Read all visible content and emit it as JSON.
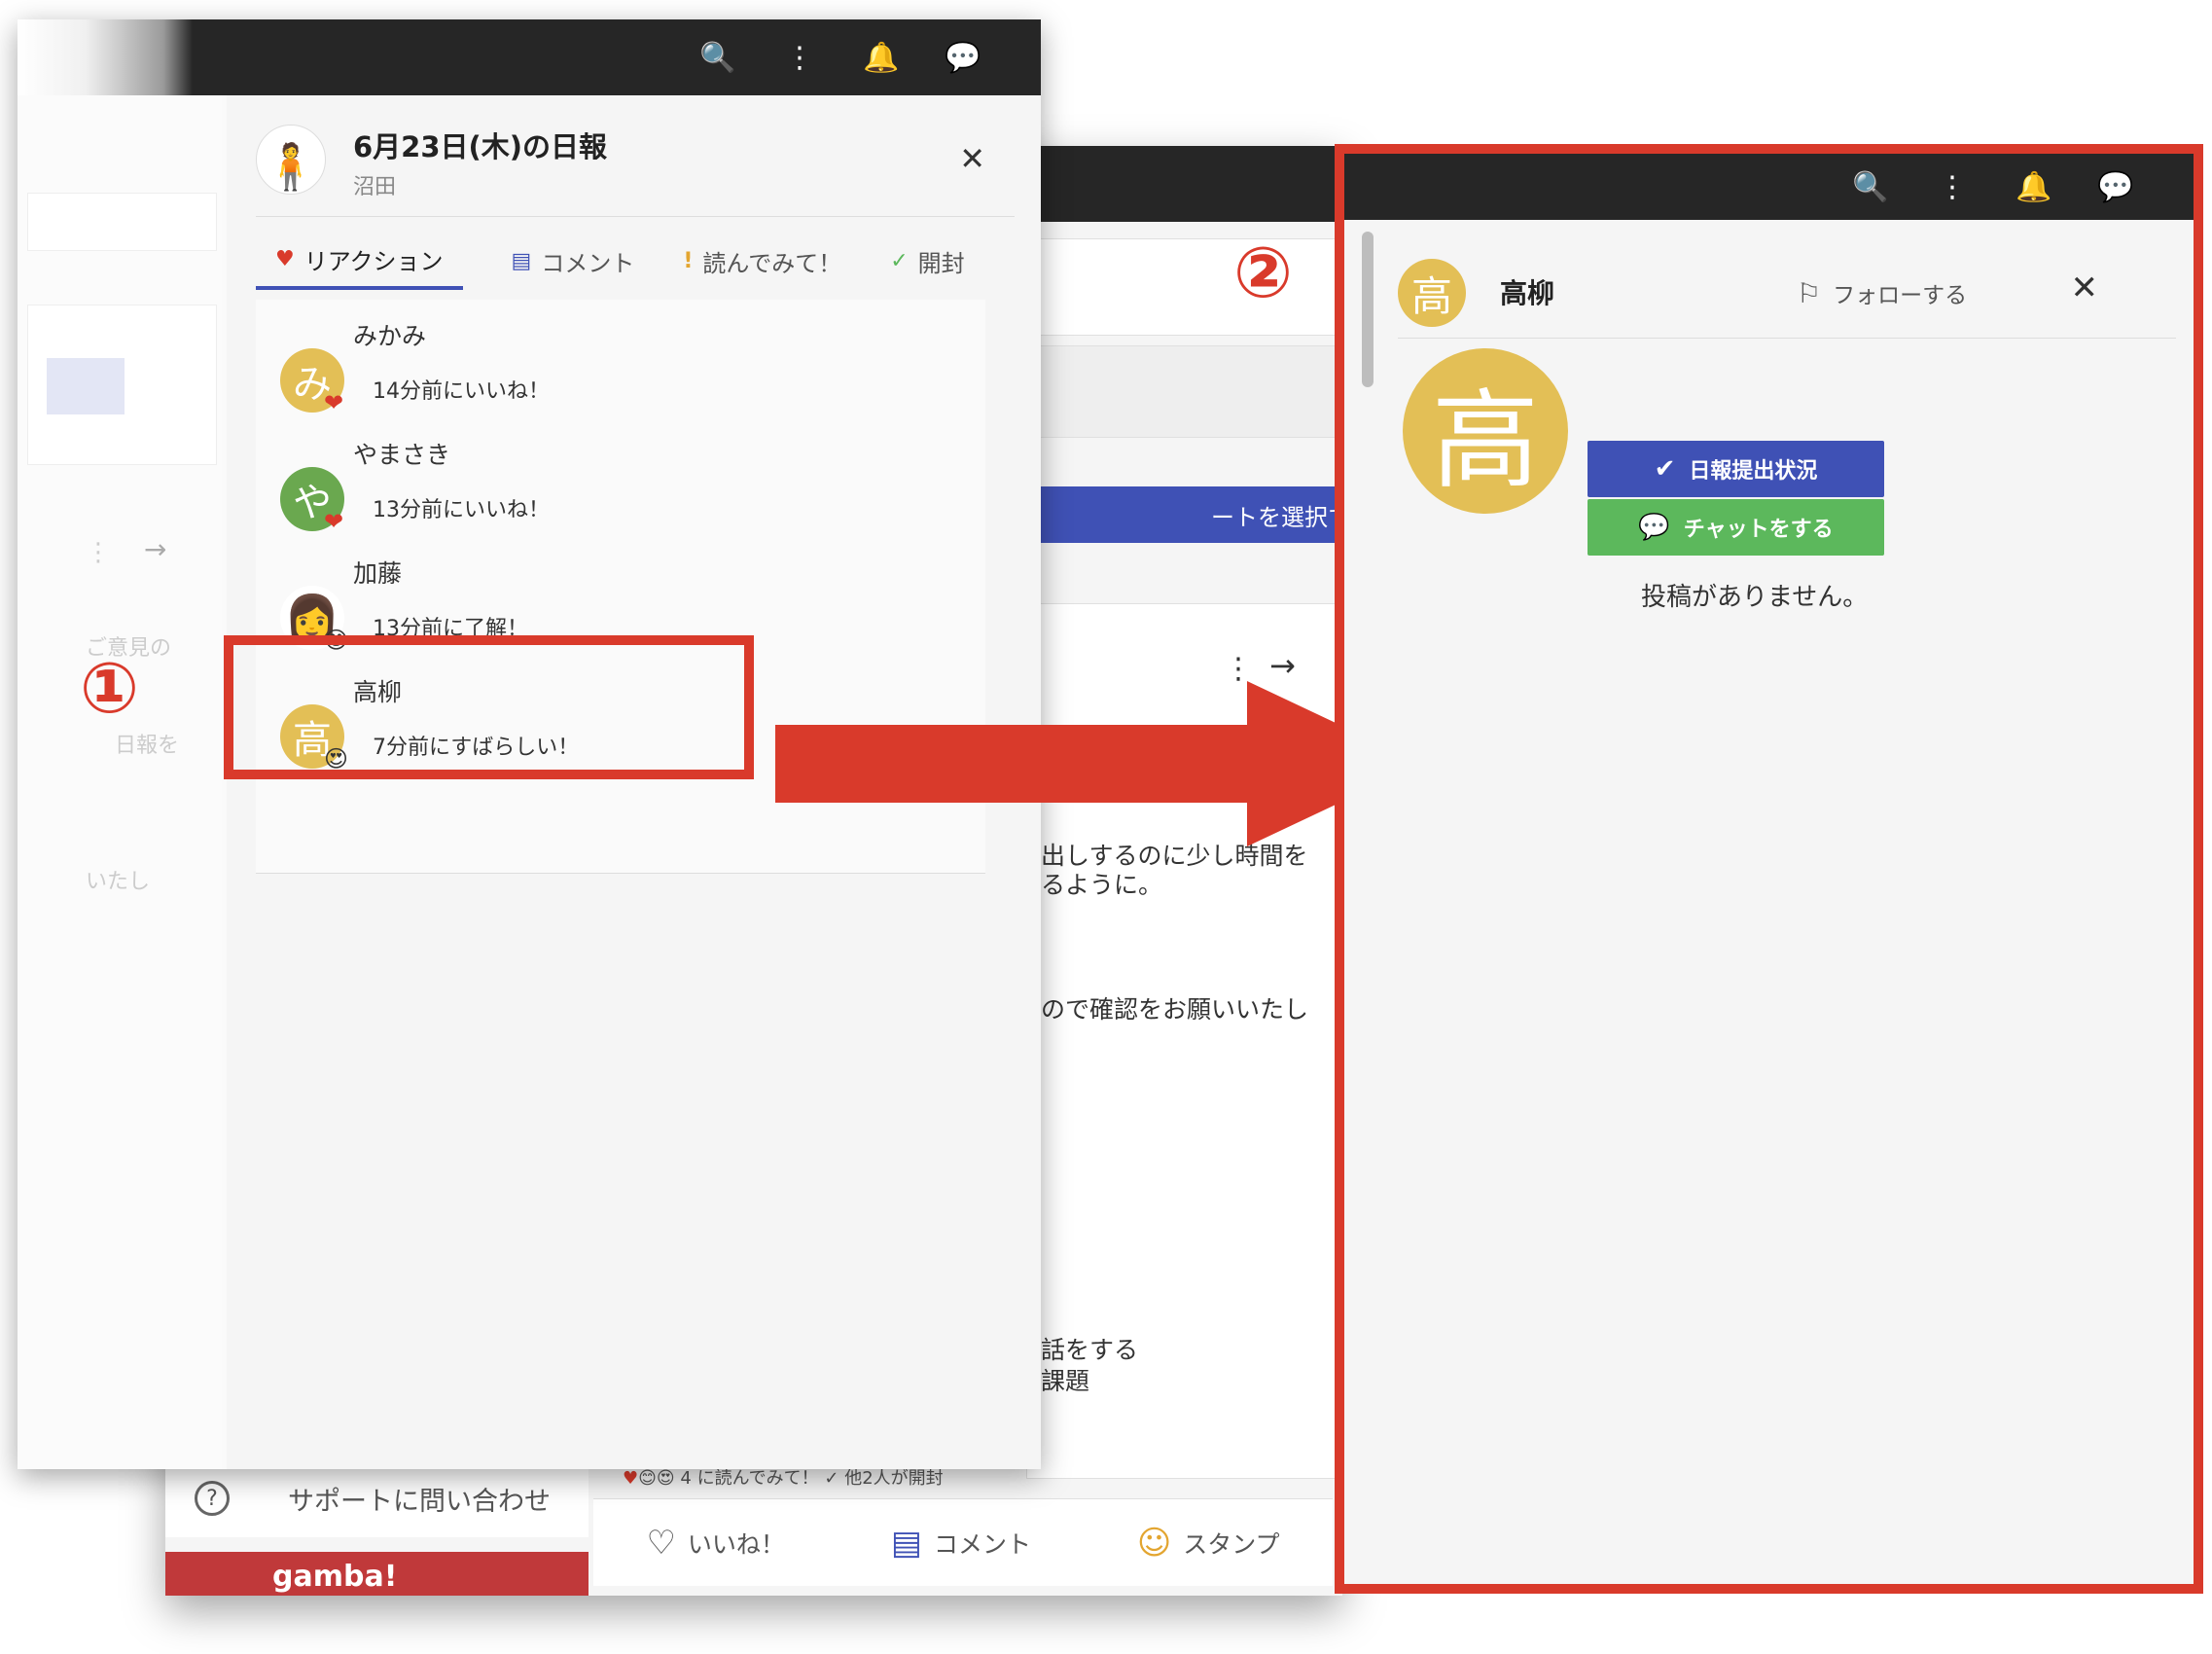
{
  "icons": {
    "search": "🔍",
    "more": "⋮",
    "bell": "🔔",
    "chat": "💬",
    "close": "✕",
    "heart": "♥",
    "arrow_right": "→",
    "flag": "⚐",
    "check": "✔",
    "smile": "☺",
    "question": "?"
  },
  "callouts": {
    "step1": "①",
    "step2": "②"
  },
  "left_panel": {
    "avatar_glyph": "🧍",
    "title": "6月23日(木)の日報",
    "author": "沼田",
    "tabs": [
      {
        "label": "リアクション",
        "icon": "♥"
      },
      {
        "label": "コメント",
        "icon": "▤"
      },
      {
        "label": "読んでみて！",
        "icon": "!"
      },
      {
        "label": "開封",
        "icon": "✓"
      }
    ],
    "reactions": [
      {
        "name": "みかみ",
        "avatar": "み",
        "color": "#e3bf56",
        "badge": "❤",
        "message": "14分前にいいね！"
      },
      {
        "name": "やまさき",
        "avatar": "や",
        "color": "#6aa84f",
        "badge": "❤",
        "message": "13分前にいいね！"
      },
      {
        "name": "加藤",
        "avatar": "👩",
        "color": "#ffffff",
        "badge": "😊",
        "message": "13分前に了解！"
      },
      {
        "name": "高柳",
        "avatar": "高",
        "color": "#e3bf56",
        "badge": "😍",
        "message": "7分前にすばらしい！"
      }
    ],
    "side_faded": [
      "ご意見の",
      "日報を",
      "いたし"
    ]
  },
  "background": {
    "select_button": "ートを選択する)",
    "text_lines": [
      "出しするのに少し時間を",
      "るように。",
      "ので確認をお願いいたし",
      "話をする",
      "課題"
    ],
    "reaction_summary": "4  に読んでみて！  ✓  他2人が開封",
    "actions": [
      {
        "label": "いいね！",
        "icon": "♡"
      },
      {
        "label": "コメント",
        "icon": "▤"
      },
      {
        "label": "スタンプ",
        "icon": "☺"
      }
    ],
    "support": "サポートに問い合わせ",
    "brand": "gamba!"
  },
  "right_panel": {
    "name": "高柳",
    "avatar": "高",
    "follow_label": "フォローする",
    "button_report": "日報提出状況",
    "button_chat": "チャットをする",
    "empty_message": "投稿がありません。",
    "colors": {
      "avatar": "#e3bf56",
      "report_btn": "#3f51b5",
      "chat_btn": "#5cb85c"
    }
  },
  "colors": {
    "highlight": "#d93a2b",
    "topbar": "#262626"
  }
}
